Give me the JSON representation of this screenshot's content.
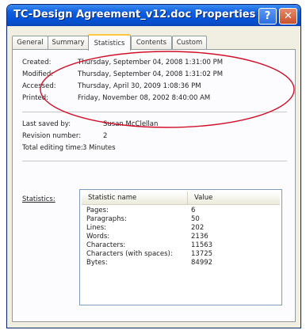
{
  "window": {
    "title": "TC-Design Agreement_v12.doc Properties",
    "help_label": "?",
    "close_label": "✕"
  },
  "tabs": [
    {
      "label": "General",
      "active": false
    },
    {
      "label": "Summary",
      "active": false
    },
    {
      "label": "Statistics",
      "active": true
    },
    {
      "label": "Contents",
      "active": false
    },
    {
      "label": "Custom",
      "active": false
    }
  ],
  "dates": {
    "created_label": "Created:",
    "created_value": "Thursday, September 04, 2008 1:31:00 PM",
    "modified_label": "Modified:",
    "modified_value": "Thursday, September 04, 2008 1:31:02 PM",
    "accessed_label": "Accessed:",
    "accessed_value": "Thursday, April 30, 2009 1:08:36 PM",
    "printed_label": "Printed:",
    "printed_value": "Friday, November 08, 2002 8:40:00 AM"
  },
  "info": {
    "last_saved_label": "Last saved by:",
    "last_saved_value": "Susan McClellan",
    "revision_label": "Revision number:",
    "revision_value": "2",
    "editing_label": "Total editing time:",
    "editing_value": "3 Minutes"
  },
  "statistics": {
    "label": "Statistics:",
    "col_name": "Statistic name",
    "col_value": "Value",
    "rows": [
      {
        "name": "Pages:",
        "value": "6"
      },
      {
        "name": "Paragraphs:",
        "value": "50"
      },
      {
        "name": "Lines:",
        "value": "202"
      },
      {
        "name": "Words:",
        "value": "2136"
      },
      {
        "name": "Characters:",
        "value": "11563"
      },
      {
        "name": "Characters (with spaces):",
        "value": "13725"
      },
      {
        "name": "Bytes:",
        "value": "84992"
      }
    ]
  },
  "colors": {
    "titlebar": "#0553d8",
    "panel_bg": "#fcfcfe",
    "annotation": "#d0102a"
  }
}
